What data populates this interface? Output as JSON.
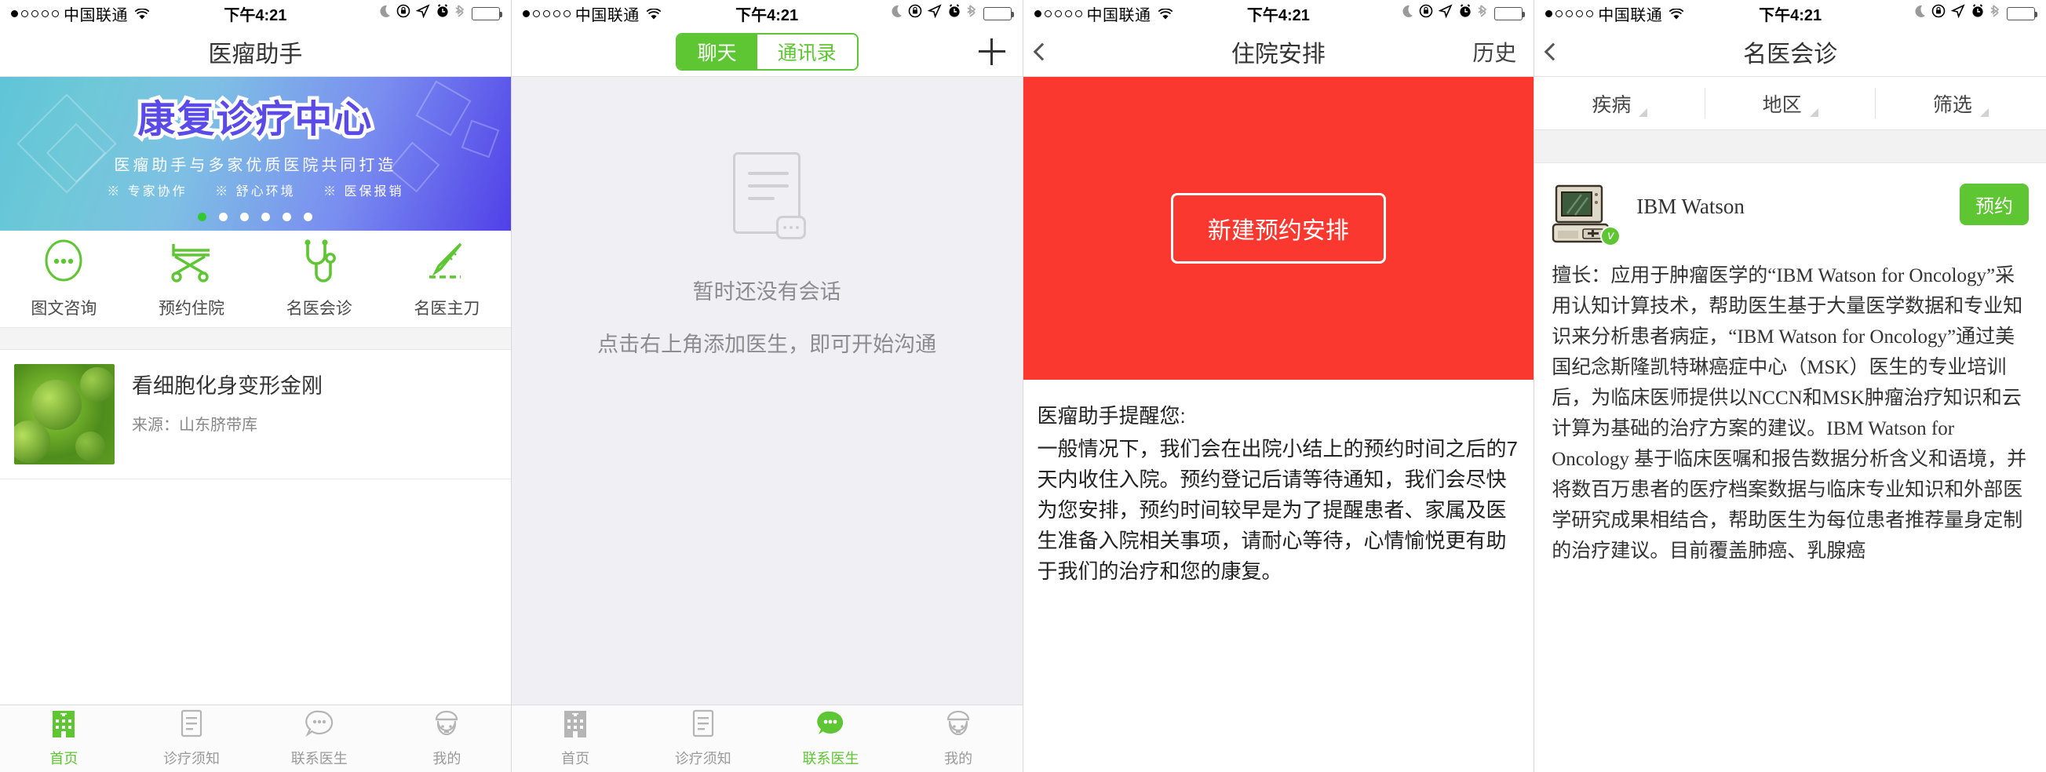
{
  "statusbar": {
    "signal_dots": [
      true,
      false,
      false,
      false,
      false
    ],
    "carrier": "中国联通",
    "time": "下午4:21",
    "icons": [
      "moon-icon",
      "rotation-lock-icon",
      "location-arrow-icon",
      "alarm-clock-icon",
      "bluetooth-icon",
      "battery-icon"
    ],
    "battery_level_pct": 22,
    "battery_color": "#ff3b30"
  },
  "theme": {
    "green": "#5ec533",
    "red": "#fb382f",
    "grey_bg": "#efeff4"
  },
  "screen1": {
    "nav": {
      "title": "医瘤助手"
    },
    "banner": {
      "title": "康复诊疗中心",
      "subtitle": "医瘤助手与多家优质医院共同打造",
      "features": [
        "※ 专家协作",
        "※ 舒心环境",
        "※ 医保报销"
      ],
      "dot_count": 6,
      "active_dot": 0
    },
    "quick_actions": [
      {
        "label": "图文咨询",
        "icon": "chat-bubble-dots-icon"
      },
      {
        "label": "预约住院",
        "icon": "hospital-bed-icon"
      },
      {
        "label": "名医会诊",
        "icon": "stethoscope-icon"
      },
      {
        "label": "名医主刀",
        "icon": "scalpel-icon"
      }
    ],
    "news": [
      {
        "title": "看细胞化身变形金刚",
        "source": "来源：山东脐带库",
        "thumb": "cell-virus-photo"
      }
    ],
    "tabs": [
      {
        "label": "首页",
        "icon": "hospital-building-icon",
        "active": true
      },
      {
        "label": "诊疗须知",
        "icon": "document-icon",
        "active": false
      },
      {
        "label": "联系医生",
        "icon": "speech-bubble-dots-icon",
        "active": false
      },
      {
        "label": "我的",
        "icon": "doctor-head-icon",
        "active": false
      }
    ]
  },
  "screen2": {
    "nav": {
      "segments": [
        {
          "label": "聊天",
          "active": true
        },
        {
          "label": "通讯录",
          "active": false
        }
      ],
      "add_icon": "plus-icon"
    },
    "empty": {
      "icon": "empty-conversation-icon",
      "line1": "暂时还没有会话",
      "line2": "点击右上角添加医生，即可开始沟通"
    },
    "tabs": [
      {
        "label": "首页",
        "icon": "hospital-building-icon",
        "active": false
      },
      {
        "label": "诊疗须知",
        "icon": "document-icon",
        "active": false
      },
      {
        "label": "联系医生",
        "icon": "speech-bubble-dots-icon",
        "active": true
      },
      {
        "label": "我的",
        "icon": "doctor-head-icon",
        "active": false
      }
    ]
  },
  "screen3": {
    "nav": {
      "back_icon": "chevron-left-icon",
      "title": "住院安排",
      "right_label": "历史"
    },
    "hero": {
      "button_label": "新建预约安排"
    },
    "notice": {
      "title": "医瘤助手提醒您:",
      "body": "一般情况下，我们会在出院小结上的预约时间之后的7天内收住入院。预约登记后请等待通知，我们会尽快为您安排，预约时间较早是为了提醒患者、家属及医生准备入院相关事项，请耐心等待，心情愉悦更有助于我们的治疗和您的康复。"
    }
  },
  "screen4": {
    "nav": {
      "back_icon": "chevron-left-icon",
      "title": "名医会诊"
    },
    "filters": [
      {
        "label": "疾病",
        "icon": "triangle-down-icon"
      },
      {
        "label": "地区",
        "icon": "triangle-down-icon"
      },
      {
        "label": "筛选",
        "icon": "triangle-down-icon"
      }
    ],
    "doctor": {
      "avatar": "retro-computer-icon",
      "verified_badge": "v",
      "name": "IBM Watson",
      "book_label": "预约",
      "description": "擅长：应用于肿瘤医学的“IBM Watson for Oncology”采用认知计算技术，帮助医生基于大量医学数据和专业知识来分析患者病症，“IBM Watson for Oncology”通过美国纪念斯隆凯特琳癌症中心（MSK）医生的专业培训后，为临床医师提供以NCCN和MSK肿瘤治疗知识和云计算为基础的治疗方案的建议。IBM Watson for Oncology 基于临床医嘱和报告数据分析含义和语境，并将数百万患者的医疗档案数据与临床专业知识和外部医学研究成果相结合，帮助医生为每位患者推荐量身定制的治疗建议。目前覆盖肺癌、乳腺癌"
    }
  }
}
